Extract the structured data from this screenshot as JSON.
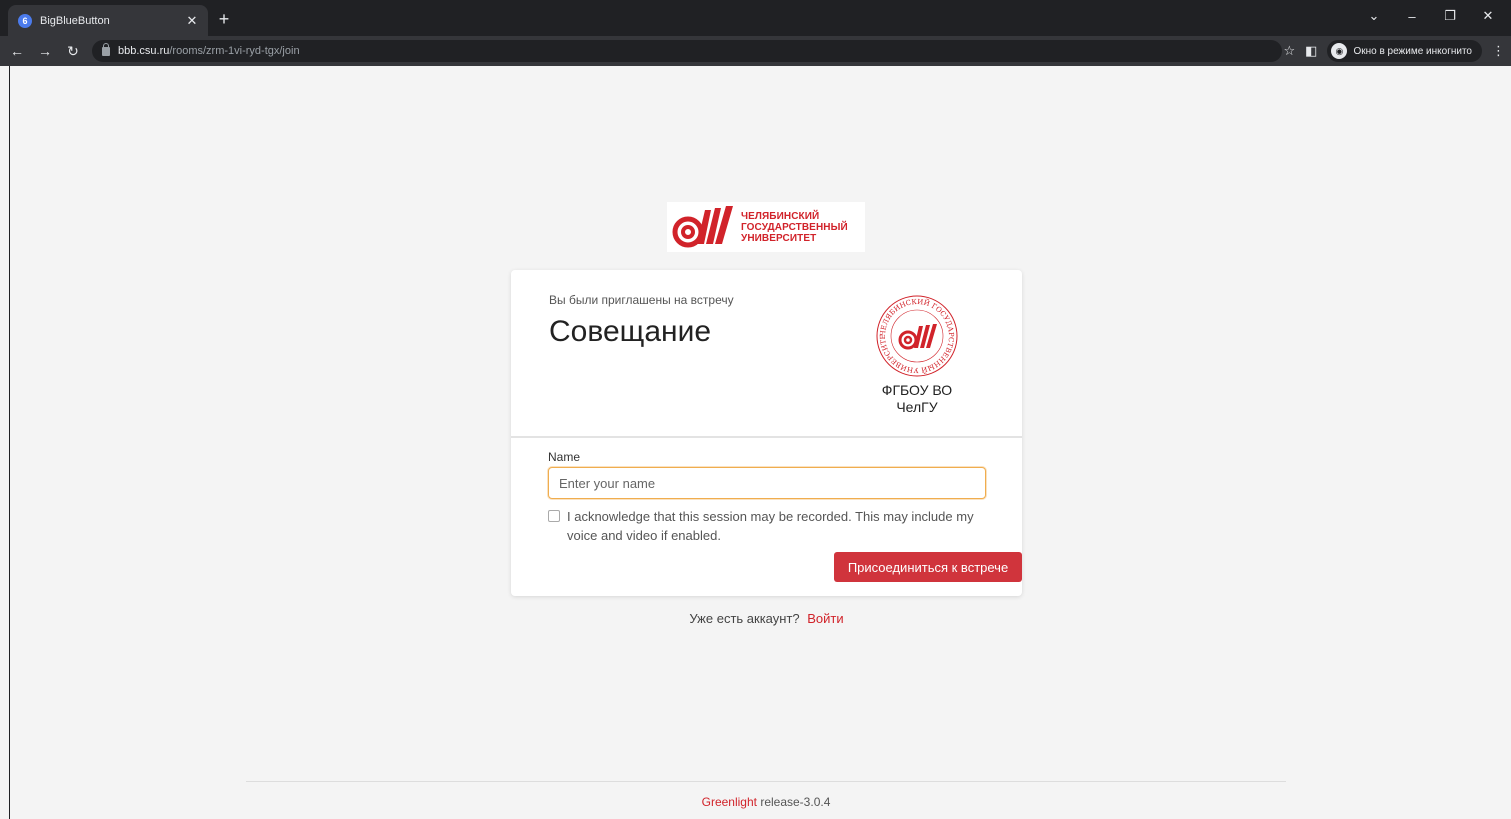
{
  "browser": {
    "tab_title": "BigBlueButton",
    "tab_favicon": "6",
    "url_host": "bbb.csu.ru",
    "url_path": "/rooms/zrm-1vi-ryd-tgx/join",
    "incognito_label": "Окно в режиме инкогнито"
  },
  "logo": {
    "line1": "ЧЕЛЯБИНСКИЙ",
    "line2": "ГОСУДАРСТВЕННЫЙ",
    "line3": "УНИВЕРСИТЕТ",
    "seal_text": "ЧЕЛЯБИНСКИЙ ГОСУДАРСТВЕННЫЙ УНИВЕРСИТЕТ",
    "brand_color": "#d1232a"
  },
  "card": {
    "invited_text": "Вы были приглашены на встречу",
    "meeting_title": "Совещание",
    "org_line1": "ФГБОУ ВО",
    "org_line2": "ЧелГУ"
  },
  "form": {
    "name_label": "Name",
    "name_value": "",
    "name_placeholder": "Enter your name",
    "ack_checked": false,
    "ack_text": "I acknowledge that this session may be recorded. This may include my voice and video if enabled.",
    "join_label": "Присоединиться к встрече"
  },
  "signin": {
    "prompt": "Уже есть аккаунт?",
    "link": "Войти"
  },
  "footer": {
    "link": "Greenlight",
    "version": "release-3.0.4"
  }
}
